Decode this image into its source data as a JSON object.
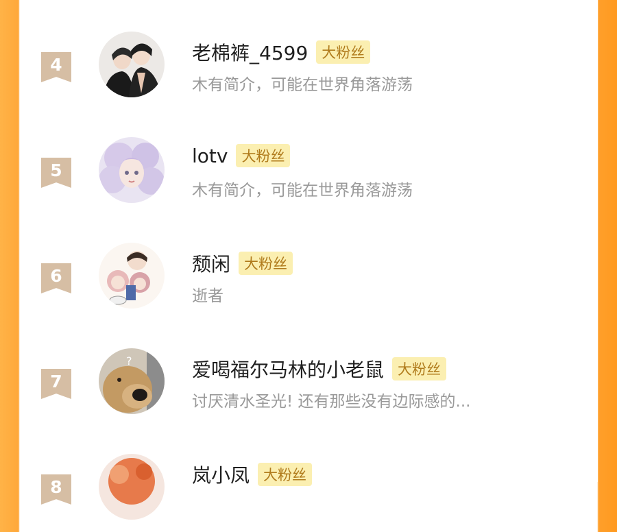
{
  "accent_colors": {
    "orange": "#ffa83a",
    "badge_bg": "#fbefb1",
    "badge_text": "#b07b1c",
    "rank_bg": "#d6bea4"
  },
  "fans": [
    {
      "rank": "4",
      "name": "老棉裤_4599",
      "badge": "大粉丝",
      "bio": "木有简介，可能在世界角落游荡",
      "avatar": "avatar-icon"
    },
    {
      "rank": "5",
      "name": "lotv",
      "badge": "大粉丝",
      "bio": "木有简介，可能在世界角落游荡",
      "avatar": "avatar-icon"
    },
    {
      "rank": "6",
      "name": "颓闲",
      "badge": "大粉丝",
      "bio": "逝者",
      "avatar": "avatar-icon"
    },
    {
      "rank": "7",
      "name": "爱喝福尔马林的小老鼠",
      "badge": "大粉丝",
      "bio": "讨厌清水圣光! 还有那些没有边际感的...",
      "avatar": "avatar-icon"
    },
    {
      "rank": "8",
      "name": "岚小凤",
      "badge": "大粉丝",
      "bio": "",
      "avatar": "avatar-icon"
    }
  ]
}
